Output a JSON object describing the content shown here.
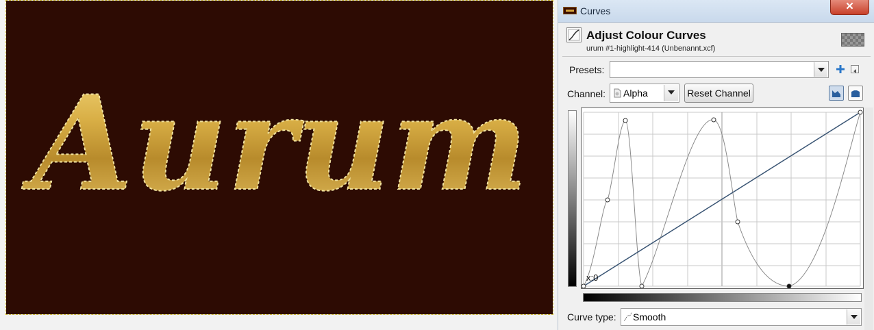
{
  "canvas": {
    "artwork_text": "Aurum",
    "background_color": "#2d0b03",
    "text_color": "#d6ac44"
  },
  "dialog": {
    "window_title": "Curves",
    "close_glyph": "✕",
    "header_title": "Adjust Colour Curves",
    "header_subtitle": "urum #1-highlight-414 (Unbenannt.xcf)",
    "presets_label": "Presets:",
    "presets_value": "",
    "channel_label": "Channel:",
    "channel_value": "Alpha",
    "reset_channel_label": "Reset Channel",
    "curve_type_label": "Curve type:",
    "curve_type_value": "Smooth",
    "cursor_readout": "x:0",
    "icons": {
      "title": "gimp-image-icon",
      "header": "curves-tool-icon",
      "add_preset": "plus-icon",
      "presets_menu": "menu-arrow-icon",
      "channel": "alpha-channel-icon",
      "linear_hist": "linear-histogram-icon",
      "log_hist": "logarithmic-histogram-icon",
      "curve_type": "smooth-curve-icon"
    },
    "accent_color": "#3a5574"
  }
}
